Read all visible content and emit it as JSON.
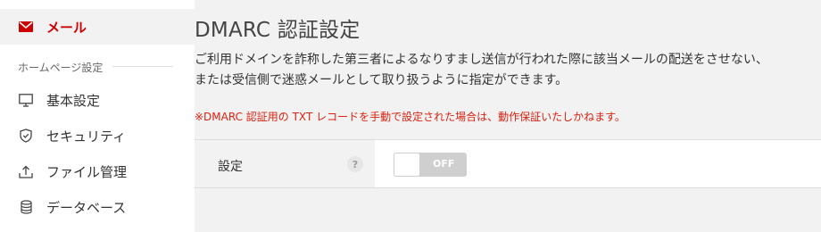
{
  "sidebar": {
    "active_item": {
      "label": "メール",
      "icon": "mail-icon"
    },
    "section_label": "ホームページ設定",
    "items": [
      {
        "label": "基本設定",
        "icon": "monitor-icon"
      },
      {
        "label": "セキュリティ",
        "icon": "shield-icon"
      },
      {
        "label": "ファイル管理",
        "icon": "upload-icon"
      },
      {
        "label": "データベース",
        "icon": "database-icon"
      }
    ]
  },
  "main": {
    "title": "DMARC 認証設定",
    "description_line1": "ご利用ドメインを詐称した第三者によるなりすまし送信が行われた際に該当メールの配送をさせない、",
    "description_line2": "または受信側で迷惑メールとして取り扱うように指定ができます。",
    "note": "※DMARC 認証用の TXT レコードを手動で設定された場合は、動作保証いたしかねます。",
    "setting": {
      "label": "設定",
      "help": "?",
      "toggle_state": "OFF"
    }
  },
  "colors": {
    "accent": "#cc0000",
    "note": "#dd2211",
    "toggle_off": "#cfcfcf"
  }
}
